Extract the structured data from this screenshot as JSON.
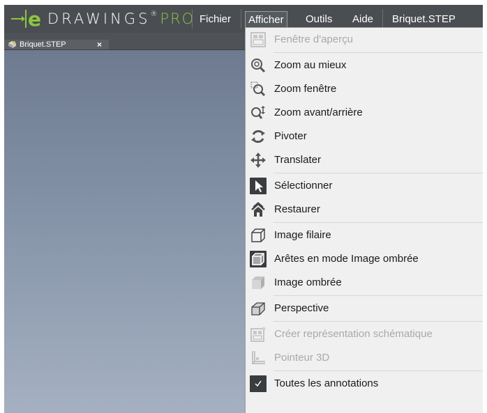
{
  "app": {
    "logo_e": "e",
    "logo_text": "DRAWINGS",
    "logo_reg": "®",
    "logo_pro": "PRO",
    "brand_green": "#8cc63f"
  },
  "menubar": {
    "items": [
      "Fichier",
      "Afficher",
      "Outils",
      "Aide"
    ],
    "document_title": "Briquet.STEP"
  },
  "tab": {
    "label": "Briquet.STEP",
    "close": "×",
    "icon": "part-icon"
  },
  "dropdown": {
    "items": [
      {
        "label": "Fenêtre d'aperçu",
        "icon": "preview-window-icon",
        "enabled": false
      },
      {
        "label": "Zoom au mieux",
        "icon": "zoom-fit-icon",
        "enabled": true
      },
      {
        "label": "Zoom fenêtre",
        "icon": "zoom-window-icon",
        "enabled": true
      },
      {
        "label": "Zoom avant/arrière",
        "icon": "zoom-in-out-icon",
        "enabled": true
      },
      {
        "label": "Pivoter",
        "icon": "rotate-icon",
        "enabled": true
      },
      {
        "label": "Translater",
        "icon": "pan-icon",
        "enabled": true
      },
      {
        "label": "Sélectionner",
        "icon": "select-arrow-icon",
        "enabled": true,
        "active": true
      },
      {
        "label": "Restaurer",
        "icon": "home-icon",
        "enabled": true
      },
      {
        "label": "Image filaire",
        "icon": "wireframe-icon",
        "enabled": true
      },
      {
        "label": "Arêtes en mode Image ombrée",
        "icon": "shaded-edges-icon",
        "enabled": true,
        "active": true
      },
      {
        "label": "Image ombrée",
        "icon": "shaded-icon",
        "enabled": true
      },
      {
        "label": "Perspective",
        "icon": "perspective-icon",
        "enabled": true
      },
      {
        "label": "Créer représentation schématique",
        "icon": "schematic-icon",
        "enabled": false
      },
      {
        "label": "Pointeur 3D",
        "icon": "pointer-3d-icon",
        "enabled": false
      },
      {
        "label": "Toutes les annotations",
        "icon": "check-icon",
        "enabled": true,
        "checked": true
      }
    ]
  }
}
